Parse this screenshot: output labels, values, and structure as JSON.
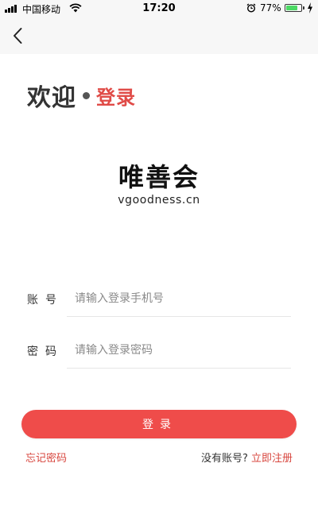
{
  "status_bar": {
    "carrier": "中国移动",
    "time": "17:20",
    "battery_percent": "77%",
    "battery_level": 0.77,
    "battery_color": "#4cd964"
  },
  "nav": {
    "back_icon": "chevron-left-icon"
  },
  "heading": {
    "welcome": "欢迎",
    "login": "登录",
    "accent_color": "#e04b47"
  },
  "logo": {
    "name_cn": "唯善会",
    "domain": "vgoodness.cn"
  },
  "form": {
    "account_label": "账号",
    "account_placeholder": "请输入登录手机号",
    "account_value": "",
    "password_label": "密码",
    "password_placeholder": "请输入登录密码",
    "password_value": "",
    "submit_label": "登录",
    "submit_color": "#ef4c4a"
  },
  "footer": {
    "forgot_label": "忘记密码",
    "no_account_label": "没有账号?",
    "register_label": "立即注册",
    "link_color": "#d8473f"
  }
}
